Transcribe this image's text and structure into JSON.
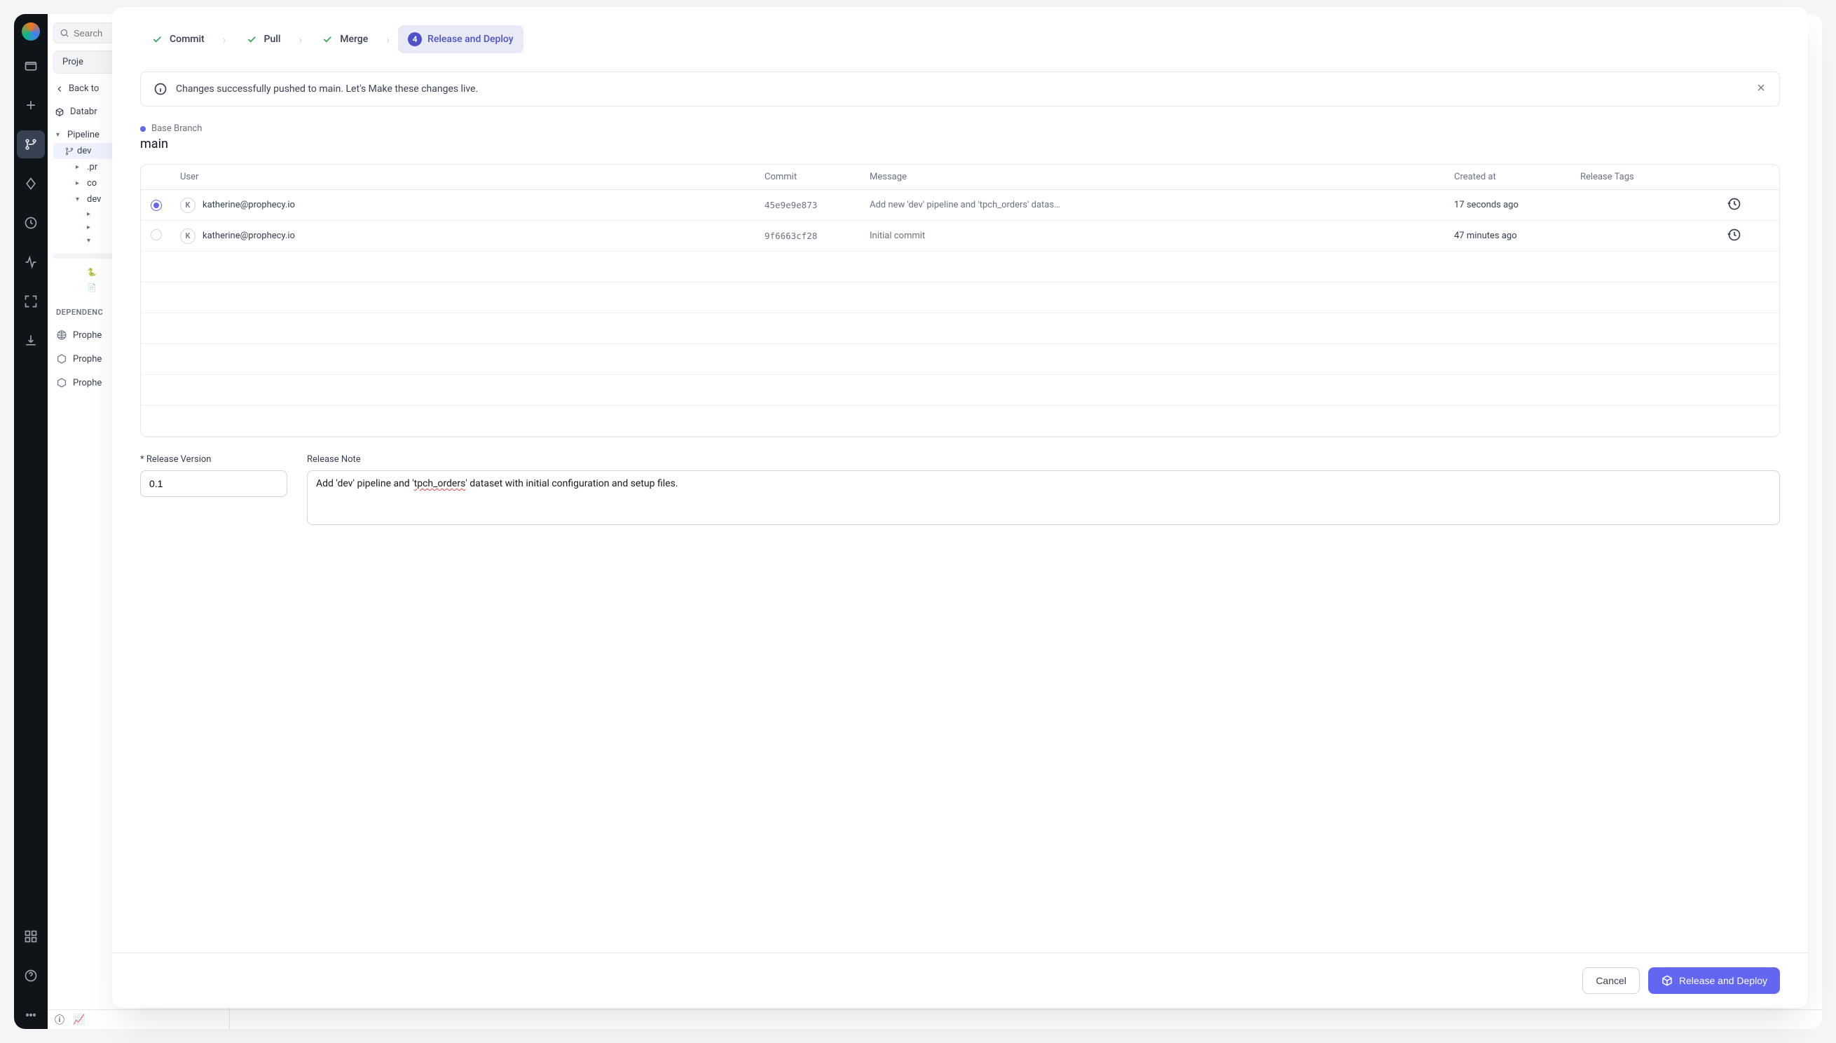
{
  "sidebar": {
    "search_placeholder": "Search",
    "project_label": "Proje",
    "back_label": "Back to",
    "env_label": "Databr",
    "tree": {
      "pipelines": "Pipeline",
      "dev": "dev",
      "pr": ".pr",
      "cod": "co",
      "dev2": "dev",
      "c1": "",
      "c2": "",
      "c3": ""
    },
    "dep_header": "DEPENDENC",
    "deps": [
      "Prophe",
      "Prophe",
      "Prophe"
    ]
  },
  "modal": {
    "stepper": {
      "commit": "Commit",
      "pull": "Pull",
      "merge": "Merge",
      "num": "4",
      "release": "Release and Deploy"
    },
    "banner": "Changes successfully pushed to main. Let's Make these changes live.",
    "base_branch_label": "Base Branch",
    "base_branch_name": "main",
    "table": {
      "headers": {
        "user": "User",
        "commit": "Commit",
        "message": "Message",
        "created": "Created at",
        "tags": "Release Tags"
      },
      "rows": [
        {
          "avatar": "K",
          "user": "katherine@prophecy.io",
          "hash": "45e9e9e873",
          "msg": "Add new 'dev' pipeline and 'tpch_orders' datas…",
          "time": "17 seconds ago",
          "selected": true
        },
        {
          "avatar": "K",
          "user": "katherine@prophecy.io",
          "hash": "9f6663cf28",
          "msg": "Initial commit",
          "time": "47 minutes ago",
          "selected": false
        }
      ]
    },
    "version_label": "* Release Version",
    "version_value": "0.1",
    "note_label": "Release Note",
    "note_value_pre": "Add 'dev' pipeline and '",
    "note_value_sq": "tpch_orders",
    "note_value_post": "' dataset with initial configuration and setup files.",
    "cancel": "Cancel",
    "deploy": "Release and Deploy"
  }
}
